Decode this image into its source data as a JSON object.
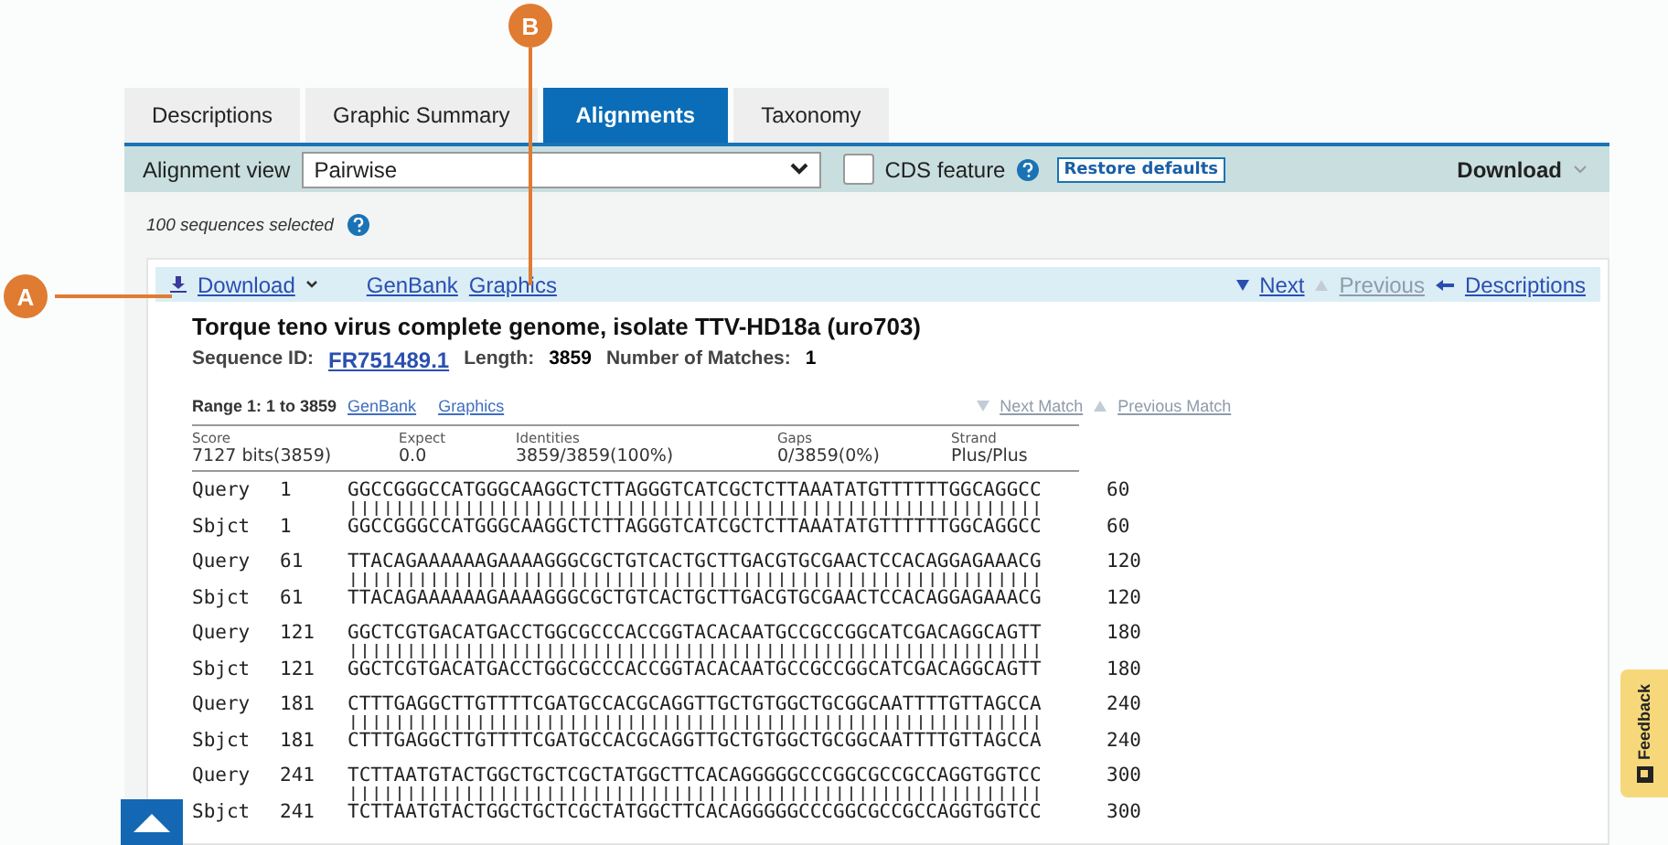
{
  "tabs": [
    {
      "label": "Descriptions",
      "selected": false
    },
    {
      "label": "Graphic Summary",
      "selected": false
    },
    {
      "label": "Alignments",
      "selected": true
    },
    {
      "label": "Taxonomy",
      "selected": false
    }
  ],
  "toolbar": {
    "view_label": "Alignment view",
    "view_value": "Pairwise",
    "cds_label": "CDS feature",
    "cds_checked": false,
    "restore_button": "Restore defaults",
    "download_menu": "Download"
  },
  "selection_note": "100 sequences selected",
  "hit_nav": {
    "download": "Download",
    "links": [
      "GenBank",
      "Graphics"
    ],
    "pager": [
      {
        "label": "Next",
        "disabled": false,
        "kind": "down"
      },
      {
        "label": "Previous",
        "disabled": true,
        "kind": "up"
      },
      {
        "label": "Descriptions",
        "disabled": false,
        "kind": "back"
      }
    ]
  },
  "hit": {
    "title": "Torque teno virus complete genome, isolate TTV-HD18a (uro703)",
    "facts": [
      {
        "label": "Sequence ID:",
        "value": "FR751489.1",
        "kind": "link"
      },
      {
        "label": "Length:",
        "value": "3859",
        "kind": "text"
      },
      {
        "label": "Number of Matches:",
        "value": "1",
        "kind": "text"
      }
    ]
  },
  "range": {
    "label": "Range 1: 1 to 3859",
    "links": [
      "GenBank",
      "Graphics"
    ],
    "matches": [
      {
        "label": "Next Match",
        "disabled": true,
        "kind": "down"
      },
      {
        "label": "Previous Match",
        "disabled": true,
        "kind": "up"
      }
    ]
  },
  "stats": [
    {
      "label": "Score",
      "value": "7127 bits(3859)"
    },
    {
      "label": "Expect",
      "value": "0.0"
    },
    {
      "label": "Identities",
      "value": "3859/3859(100%)"
    },
    {
      "label": "Gaps",
      "value": "0/3859(0%)"
    },
    {
      "label": "Strand",
      "value": "Plus/Plus"
    }
  ],
  "alignment": [
    {
      "query": "Query",
      "q_start": "1",
      "q_seq": "GGCCGGGCCATGGGCAAGGCTCTTAGGGTCATCGCTCTTAAATATGTTTTTTGGCAGGCC",
      "q_end": "60",
      "sbjct": "Sbjct",
      "s_start": "1",
      "s_seq": "GGCCGGGCCATGGGCAAGGCTCTTAGGGTCATCGCTCTTAAATATGTTTTTTGGCAGGCC",
      "s_end": "60"
    },
    {
      "query": "Query",
      "q_start": "61",
      "q_seq": "TTACAGAAAAAAGAAAAGGGCGCTGTCACTGCTTGACGTGCGAACTCCACAGGAGAAACG",
      "q_end": "120",
      "sbjct": "Sbjct",
      "s_start": "61",
      "s_seq": "TTACAGAAAAAAGAAAAGGGCGCTGTCACTGCTTGACGTGCGAACTCCACAGGAGAAACG",
      "s_end": "120"
    },
    {
      "query": "Query",
      "q_start": "121",
      "q_seq": "GGCTCGTGACATGACCTGGCGCCCACCGGTACACAATGCCGCCGGCATCGACAGGCAGTT",
      "q_end": "180",
      "sbjct": "Sbjct",
      "s_start": "121",
      "s_seq": "GGCTCGTGACATGACCTGGCGCCCACCGGTACACAATGCCGCCGGCATCGACAGGCAGTT",
      "s_end": "180"
    },
    {
      "query": "Query",
      "q_start": "181",
      "q_seq": "CTTTGAGGCTTGTTTTCGATGCCACGCAGGTTGCTGTGGCTGCGGCAATTTTGTTAGCCA",
      "q_end": "240",
      "sbjct": "Sbjct",
      "s_start": "181",
      "s_seq": "CTTTGAGGCTTGTTTTCGATGCCACGCAGGTTGCTGTGGCTGCGGCAATTTTGTTAGCCA",
      "s_end": "240"
    },
    {
      "query": "Query",
      "q_start": "241",
      "q_seq": "TCTTAATGTACTGGCTGCTCGCTATGGCTTCACAGGGGGCCCGGCGCCGCCAGGTGGTCC",
      "q_end": "300",
      "sbjct": "Sbjct",
      "s_start": "241",
      "s_seq": "TCTTAATGTACTGGCTGCTCGCTATGGCTTCACAGGGGGCCCGGCGCCGCCAGGTGGTCC",
      "s_end": "300"
    }
  ],
  "callouts": [
    {
      "label": "A",
      "kind": "horizontal"
    },
    {
      "label": "B",
      "kind": "vertical"
    }
  ],
  "feedback": "Feedback"
}
